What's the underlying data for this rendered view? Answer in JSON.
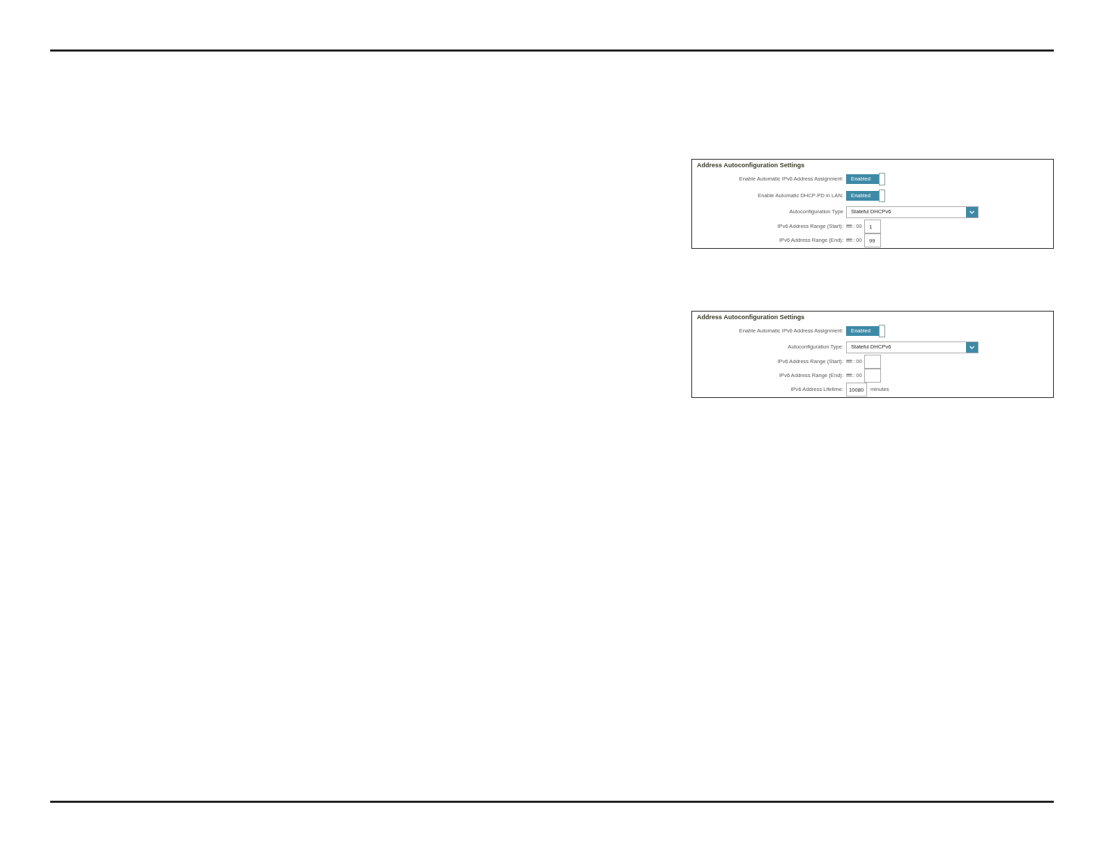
{
  "panels": [
    {
      "title": "Address Autoconfiguration Settings",
      "rows": [
        {
          "kind": "toggle",
          "label": "Enable Automatic IPv6 Address Assignment:",
          "value": "Enabled",
          "on": true
        },
        {
          "kind": "toggle",
          "label": "Enable Automatic DHCP-PD in LAN:",
          "value": "Enabled",
          "on": true
        },
        {
          "kind": "select",
          "label": "Autoconfiguration Type",
          "value": "Stateful DHCPv6"
        },
        {
          "kind": "range",
          "label": "IPv6 Address Range (Start):",
          "prefix": "ffff:: 00",
          "value": "1"
        },
        {
          "kind": "range",
          "label": "IPv6 Address Range (End):",
          "prefix": "ffff:: 00",
          "value": "99"
        }
      ]
    },
    {
      "title": "Address Autoconfiguration Settings",
      "rows": [
        {
          "kind": "toggle",
          "label": "Enable Automatic IPv6 Address Assignment:",
          "value": "Enabled",
          "on": true
        },
        {
          "kind": "select",
          "label": "Autoconfiguration Type:",
          "value": "Stateful DHCPv6"
        },
        {
          "kind": "range",
          "label": "IPv6 Address Range (Start):",
          "prefix": "ffff:: 00"
        },
        {
          "kind": "range",
          "label": "IPv6 Address Range (End):",
          "prefix": "ffff:: 00"
        },
        {
          "kind": "duration",
          "label": "IPv6 Address Lifetime:",
          "value": "10080",
          "unit": "minutes"
        }
      ]
    }
  ]
}
